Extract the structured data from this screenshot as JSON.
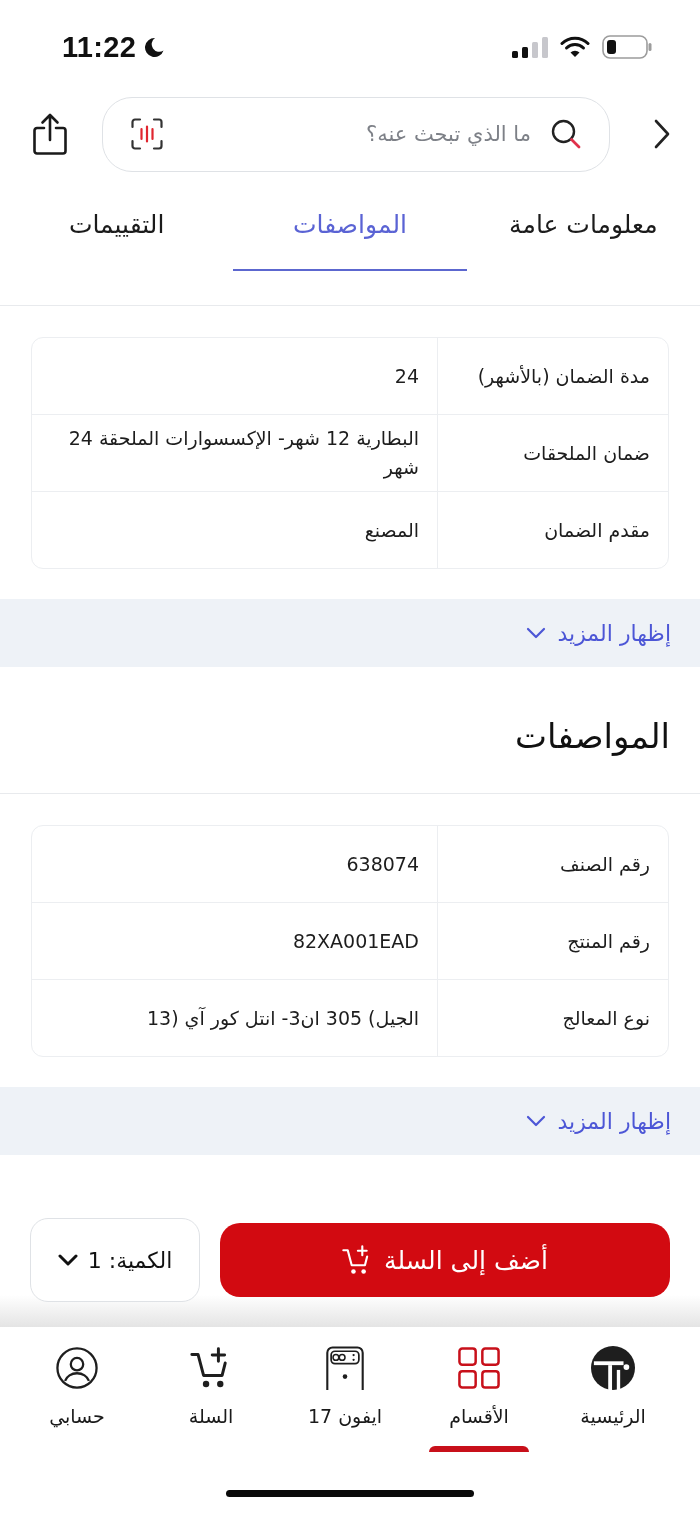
{
  "status_bar": {
    "time": "11:22"
  },
  "header": {
    "search": {
      "placeholder": "ما الذي تبحث عنه؟"
    }
  },
  "tabs": [
    {
      "label": "معلومات عامة",
      "selected": false
    },
    {
      "label": "المواصفات",
      "selected": true
    },
    {
      "label": "التقييمات",
      "selected": false
    }
  ],
  "sections": [
    {
      "rows": [
        {
          "label": "مدة الضمان (بالأشهر)",
          "value": "24"
        },
        {
          "label": "ضمان الملحقات",
          "value": "البطارية 12 شهر- الإكسسوارات الملحقة 24 شهر"
        },
        {
          "label": "مقدم الضمان",
          "value": "المصنع"
        }
      ],
      "show_more": "إظهار المزيد"
    },
    {
      "title": "المواصفات",
      "rows": [
        {
          "label": "رقم الصنف",
          "value": "638074"
        },
        {
          "label": "رقم المنتج",
          "value": "82XA001EAD"
        },
        {
          "label": "نوع المعالج",
          "value": "الجيل) 305 ان3- انتل كور آي (13"
        }
      ],
      "show_more": "إظهار المزيد"
    }
  ],
  "purchase": {
    "add_to_cart": "أضف إلى السلة",
    "quantity": "الكمية: 1"
  },
  "bottom_nav": [
    {
      "kind": "home",
      "label": "الرئيسية",
      "selected": false
    },
    {
      "kind": "categories",
      "label": "الأقسام",
      "selected": true
    },
    {
      "kind": "phone",
      "label": "ايفون 17",
      "selected": false
    },
    {
      "kind": "cart",
      "label": "السلة",
      "selected": false
    },
    {
      "kind": "account",
      "label": "حسابي",
      "selected": false
    }
  ]
}
